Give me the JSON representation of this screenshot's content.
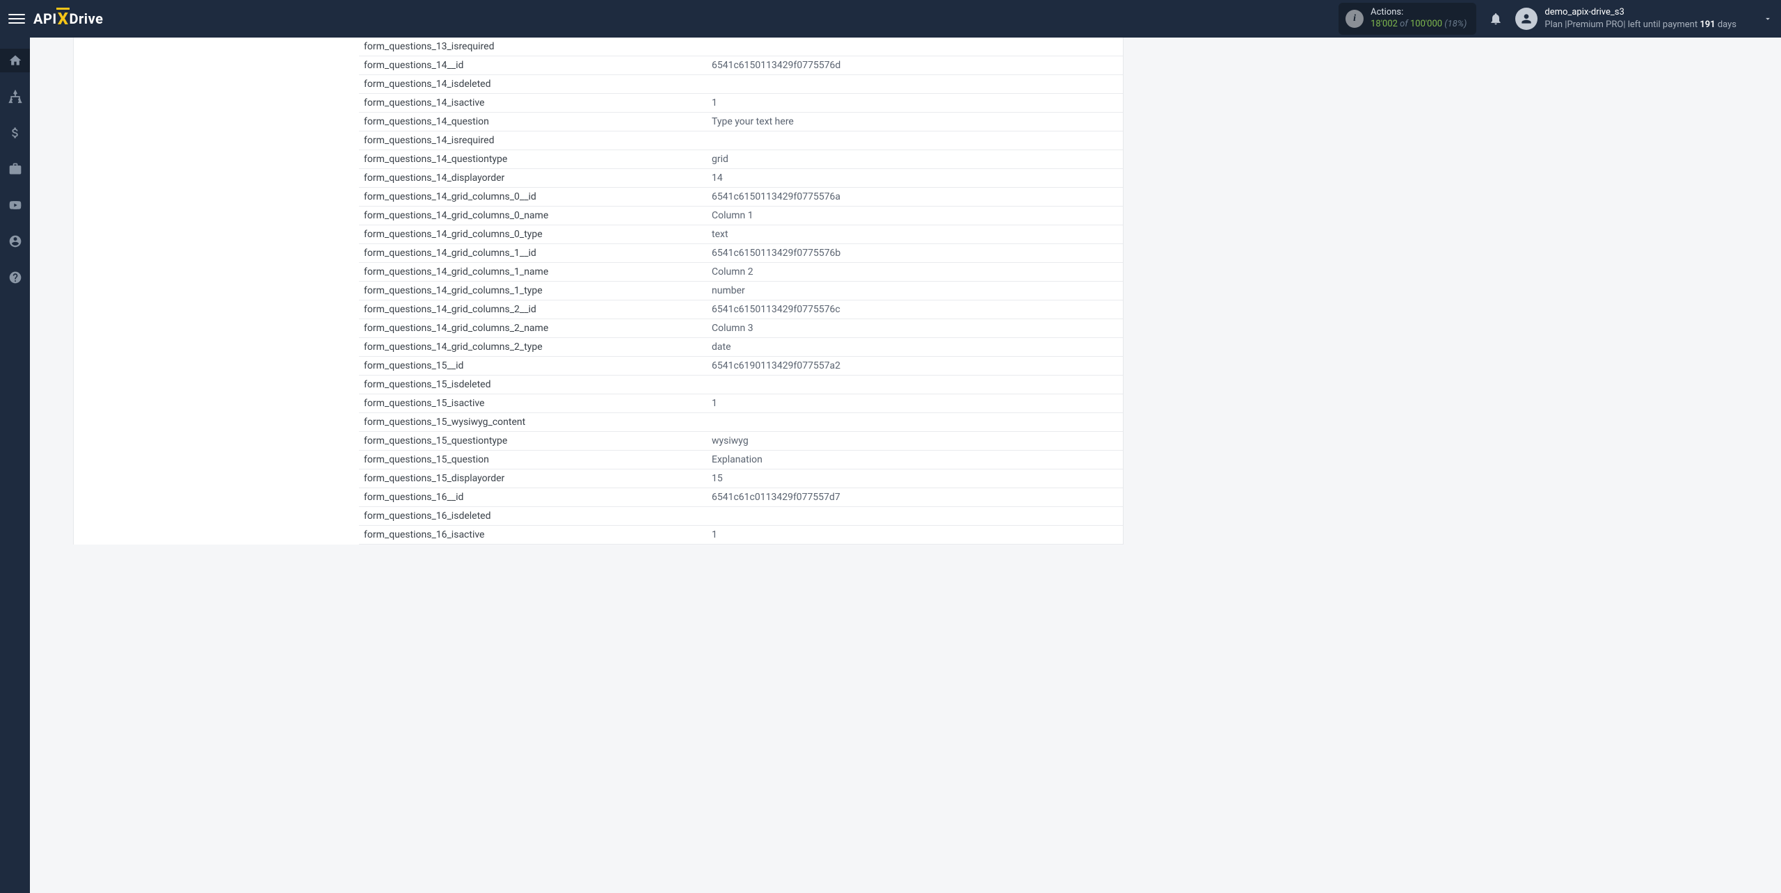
{
  "logo": {
    "api": "API",
    "x": "X",
    "drive": "Drive"
  },
  "actions": {
    "label": "Actions:",
    "used": "18'002",
    "of": "of",
    "total": "100'000",
    "pct": "(18%)"
  },
  "user": {
    "name": "demo_apix-drive_s3",
    "plan_prefix": "Plan |",
    "plan_name": "Premium PRO",
    "plan_mid": "| left until payment ",
    "days": "191",
    "days_suffix": " days"
  },
  "rows": [
    {
      "key": "form_questions_13_isrequired",
      "val": ""
    },
    {
      "key": "form_questions_14__id",
      "val": "6541c6150113429f0775576d"
    },
    {
      "key": "form_questions_14_isdeleted",
      "val": ""
    },
    {
      "key": "form_questions_14_isactive",
      "val": "1"
    },
    {
      "key": "form_questions_14_question",
      "val": "Type your text here"
    },
    {
      "key": "form_questions_14_isrequired",
      "val": ""
    },
    {
      "key": "form_questions_14_questiontype",
      "val": "grid"
    },
    {
      "key": "form_questions_14_displayorder",
      "val": "14"
    },
    {
      "key": "form_questions_14_grid_columns_0__id",
      "val": "6541c6150113429f0775576a"
    },
    {
      "key": "form_questions_14_grid_columns_0_name",
      "val": "Column 1"
    },
    {
      "key": "form_questions_14_grid_columns_0_type",
      "val": "text"
    },
    {
      "key": "form_questions_14_grid_columns_1__id",
      "val": "6541c6150113429f0775576b"
    },
    {
      "key": "form_questions_14_grid_columns_1_name",
      "val": "Column 2"
    },
    {
      "key": "form_questions_14_grid_columns_1_type",
      "val": "number"
    },
    {
      "key": "form_questions_14_grid_columns_2__id",
      "val": "6541c6150113429f0775576c"
    },
    {
      "key": "form_questions_14_grid_columns_2_name",
      "val": "Column 3"
    },
    {
      "key": "form_questions_14_grid_columns_2_type",
      "val": "date"
    },
    {
      "key": "form_questions_15__id",
      "val": "6541c6190113429f077557a2"
    },
    {
      "key": "form_questions_15_isdeleted",
      "val": ""
    },
    {
      "key": "form_questions_15_isactive",
      "val": "1"
    },
    {
      "key": "form_questions_15_wysiwyg_content",
      "val": ""
    },
    {
      "key": "form_questions_15_questiontype",
      "val": "wysiwyg"
    },
    {
      "key": "form_questions_15_question",
      "val": "Explanation"
    },
    {
      "key": "form_questions_15_displayorder",
      "val": "15"
    },
    {
      "key": "form_questions_16__id",
      "val": "6541c61c0113429f077557d7"
    },
    {
      "key": "form_questions_16_isdeleted",
      "val": ""
    },
    {
      "key": "form_questions_16_isactive",
      "val": "1"
    }
  ]
}
